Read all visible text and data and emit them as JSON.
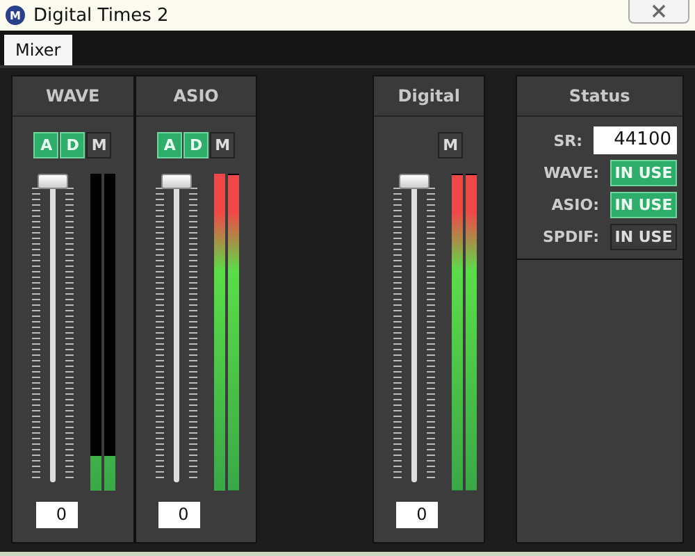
{
  "window": {
    "icon_letter": "M",
    "title": "Digital Times 2"
  },
  "tabs": [
    {
      "label": "Mixer",
      "selected": true
    }
  ],
  "channels": [
    {
      "name": "WAVE",
      "buttons": [
        {
          "label": "A",
          "on": true
        },
        {
          "label": "D",
          "on": true
        },
        {
          "label": "M",
          "on": false
        }
      ],
      "fader": {
        "level": 1
      },
      "meters": [
        {
          "level": 0.11
        },
        {
          "level": 0.11
        }
      ],
      "value": "0"
    },
    {
      "name": "ASIO",
      "buttons": [
        {
          "label": "A",
          "on": true
        },
        {
          "label": "D",
          "on": true
        },
        {
          "label": "M",
          "on": false
        }
      ],
      "fader": {
        "level": 1
      },
      "meters": [
        {
          "level": 1
        },
        {
          "level": 0.995
        }
      ],
      "value": "0"
    },
    {
      "name": "Digital",
      "buttons": [
        {
          "label": "M",
          "on": false
        }
      ],
      "fader": {
        "level": 1
      },
      "meters": [
        {
          "level": 0.995
        },
        {
          "level": 0.995
        }
      ],
      "value": "0"
    }
  ],
  "status": {
    "title": "Status",
    "sr_label": "SR:",
    "sr_value": "44100",
    "rows": [
      {
        "label": "WAVE:",
        "badge": "IN USE",
        "on": true
      },
      {
        "label": "ASIO:",
        "badge": "IN USE",
        "on": true
      },
      {
        "label": "SPDIF:",
        "badge": "IN USE",
        "on": false
      }
    ]
  }
}
